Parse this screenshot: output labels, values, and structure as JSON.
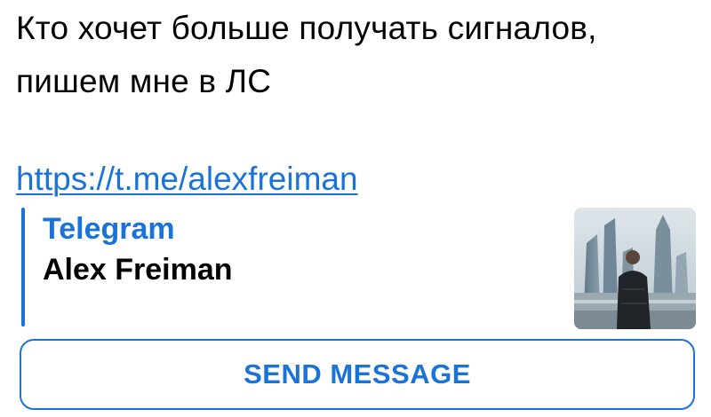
{
  "message": {
    "line1": "Кто хочет больше получать сигналов,",
    "line2": "пишем мне в ЛС",
    "link": "https://t.me/alexfreiman"
  },
  "link_preview": {
    "site_name": "Telegram",
    "title": "Alex Freiman",
    "thumbnail": "profile-photo-city-skyline",
    "accent_color": "#1a73d9"
  },
  "actions": {
    "send_message_label": "SEND MESSAGE"
  }
}
